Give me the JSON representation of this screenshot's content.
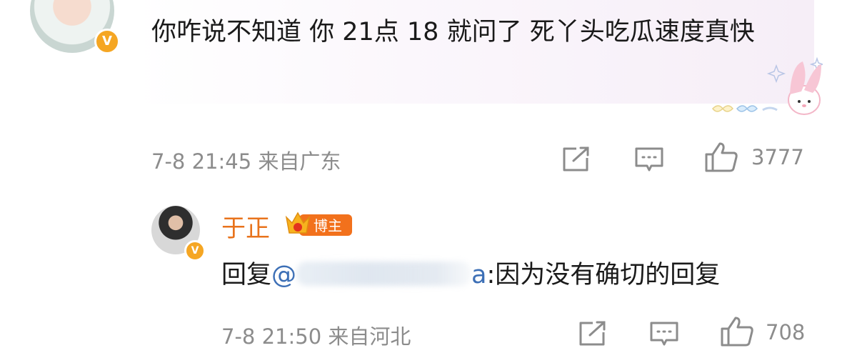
{
  "comment": {
    "text": "你咋说不知道 你 21点 18 就问了 死丫头吃瓜速度真快",
    "timestamp": "7-8 21:45",
    "location": "来自广东",
    "like_count": "3777"
  },
  "reply": {
    "author": "于正",
    "author_badge": "博主",
    "reply_prefix": "回复",
    "mention_at": "@",
    "mention_tail": "a",
    "text": ":因为没有确切的回复",
    "timestamp": "7-8 21:50",
    "location": "来自河北",
    "like_count": "708"
  },
  "icons": {
    "share": "share-icon",
    "comment": "comment-icon",
    "like": "thumbs-up-icon",
    "verified": "verified-v-icon"
  },
  "colors": {
    "author": "#e8731c",
    "mention": "#3c6fb6",
    "meta": "#8c8c8c",
    "verified": "#f5a623"
  }
}
